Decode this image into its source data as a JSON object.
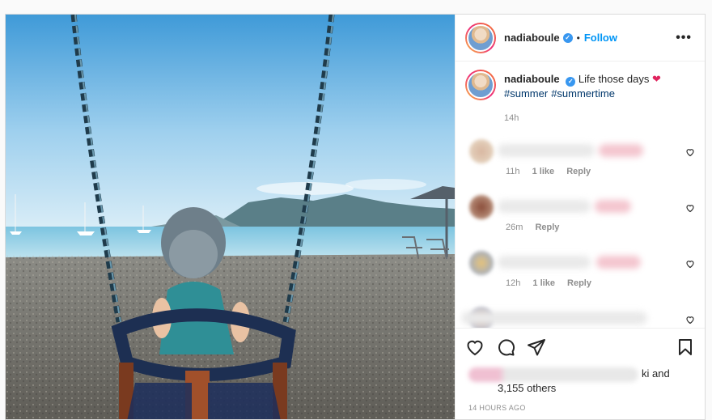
{
  "post": {
    "photo_alt": "",
    "username": "nadiaboule",
    "verified_mark": "✓",
    "separator": "•",
    "follow_label": "Follow",
    "more_label": "•••",
    "caption": {
      "text": "Life those days",
      "emoji": "❤",
      "hashtags": [
        "#summer",
        "#summertime"
      ],
      "age": "14h"
    },
    "comments": [
      {
        "age": "11h",
        "likes": "1 like",
        "reply": "Reply"
      },
      {
        "age": "26m",
        "likes": "",
        "reply": "Reply"
      },
      {
        "age": "12h",
        "likes": "1 like",
        "reply": "Reply"
      },
      {
        "age": "",
        "likes": "",
        "reply": ""
      }
    ],
    "actions": [
      "heart-icon",
      "comment-icon",
      "share-icon",
      "bookmark-icon"
    ],
    "likes_suffix": "ki and",
    "likes_others": "3,155 others",
    "timestamp": "14 HOURS AGO",
    "colors": {
      "accent": "#0095f6",
      "verified": "#3897f0",
      "heart": "#e0245e"
    }
  }
}
